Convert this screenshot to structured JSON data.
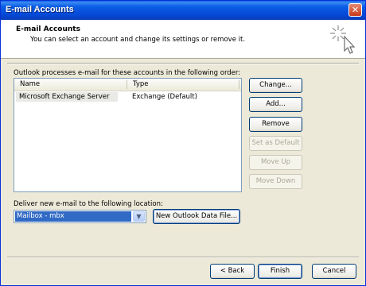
{
  "window": {
    "title": "E-mail Accounts",
    "close_glyph": "✕"
  },
  "header": {
    "title": "E-mail Accounts",
    "subtitle": "You can select an account and change its settings or remove it.",
    "icon": "wand-cursor-icon"
  },
  "accounts": {
    "caption": "Outlook processes e-mail for these accounts in the following order:",
    "columns": [
      "Name",
      "Type"
    ],
    "rows": [
      {
        "name": "Microsoft Exchange Server",
        "type": "Exchange (Default)"
      }
    ]
  },
  "side_buttons": {
    "change": "Change...",
    "add": "Add...",
    "remove": "Remove",
    "set_default": "Set as Default",
    "move_up": "Move Up",
    "move_down": "Move Down"
  },
  "deliver": {
    "caption": "Deliver new e-mail to the following location:",
    "selected": "Mailbox - mbx",
    "new_file_button": "New Outlook Data File..."
  },
  "footer": {
    "back": "< Back",
    "finish": "Finish",
    "cancel": "Cancel"
  },
  "colors": {
    "titlebar": "#0548d6",
    "dialog_bg": "#ece9d8",
    "selection": "#316ac5",
    "close": "#c8391a"
  }
}
